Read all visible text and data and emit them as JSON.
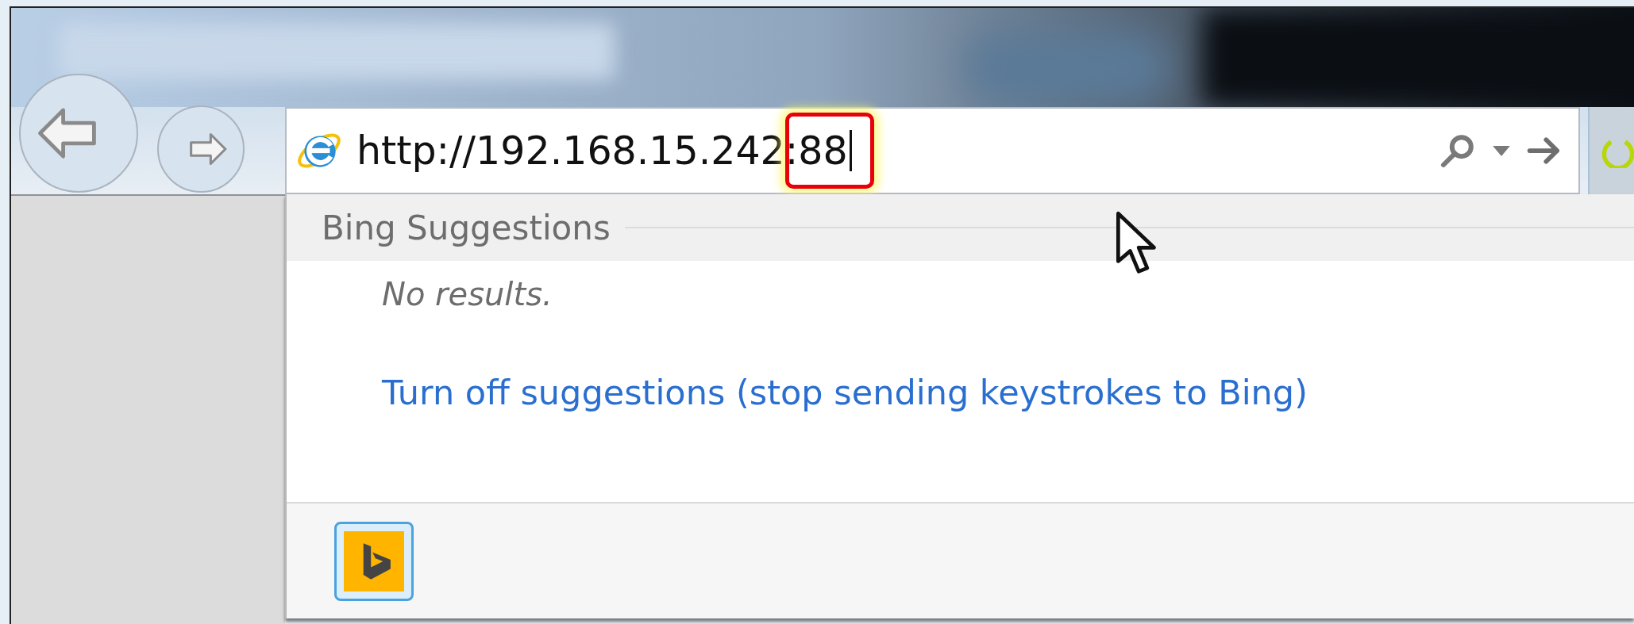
{
  "navigation": {
    "buttons": [
      {
        "kind": "back"
      },
      {
        "kind": "forward"
      }
    ]
  },
  "address_bar": {
    "value": "http://192.168.15.242:88"
  },
  "suggestions": {
    "header": "Bing Suggestions",
    "empty_message": "No results.",
    "link": "Turn off suggestions (stop sending keystrokes to Bing)"
  }
}
